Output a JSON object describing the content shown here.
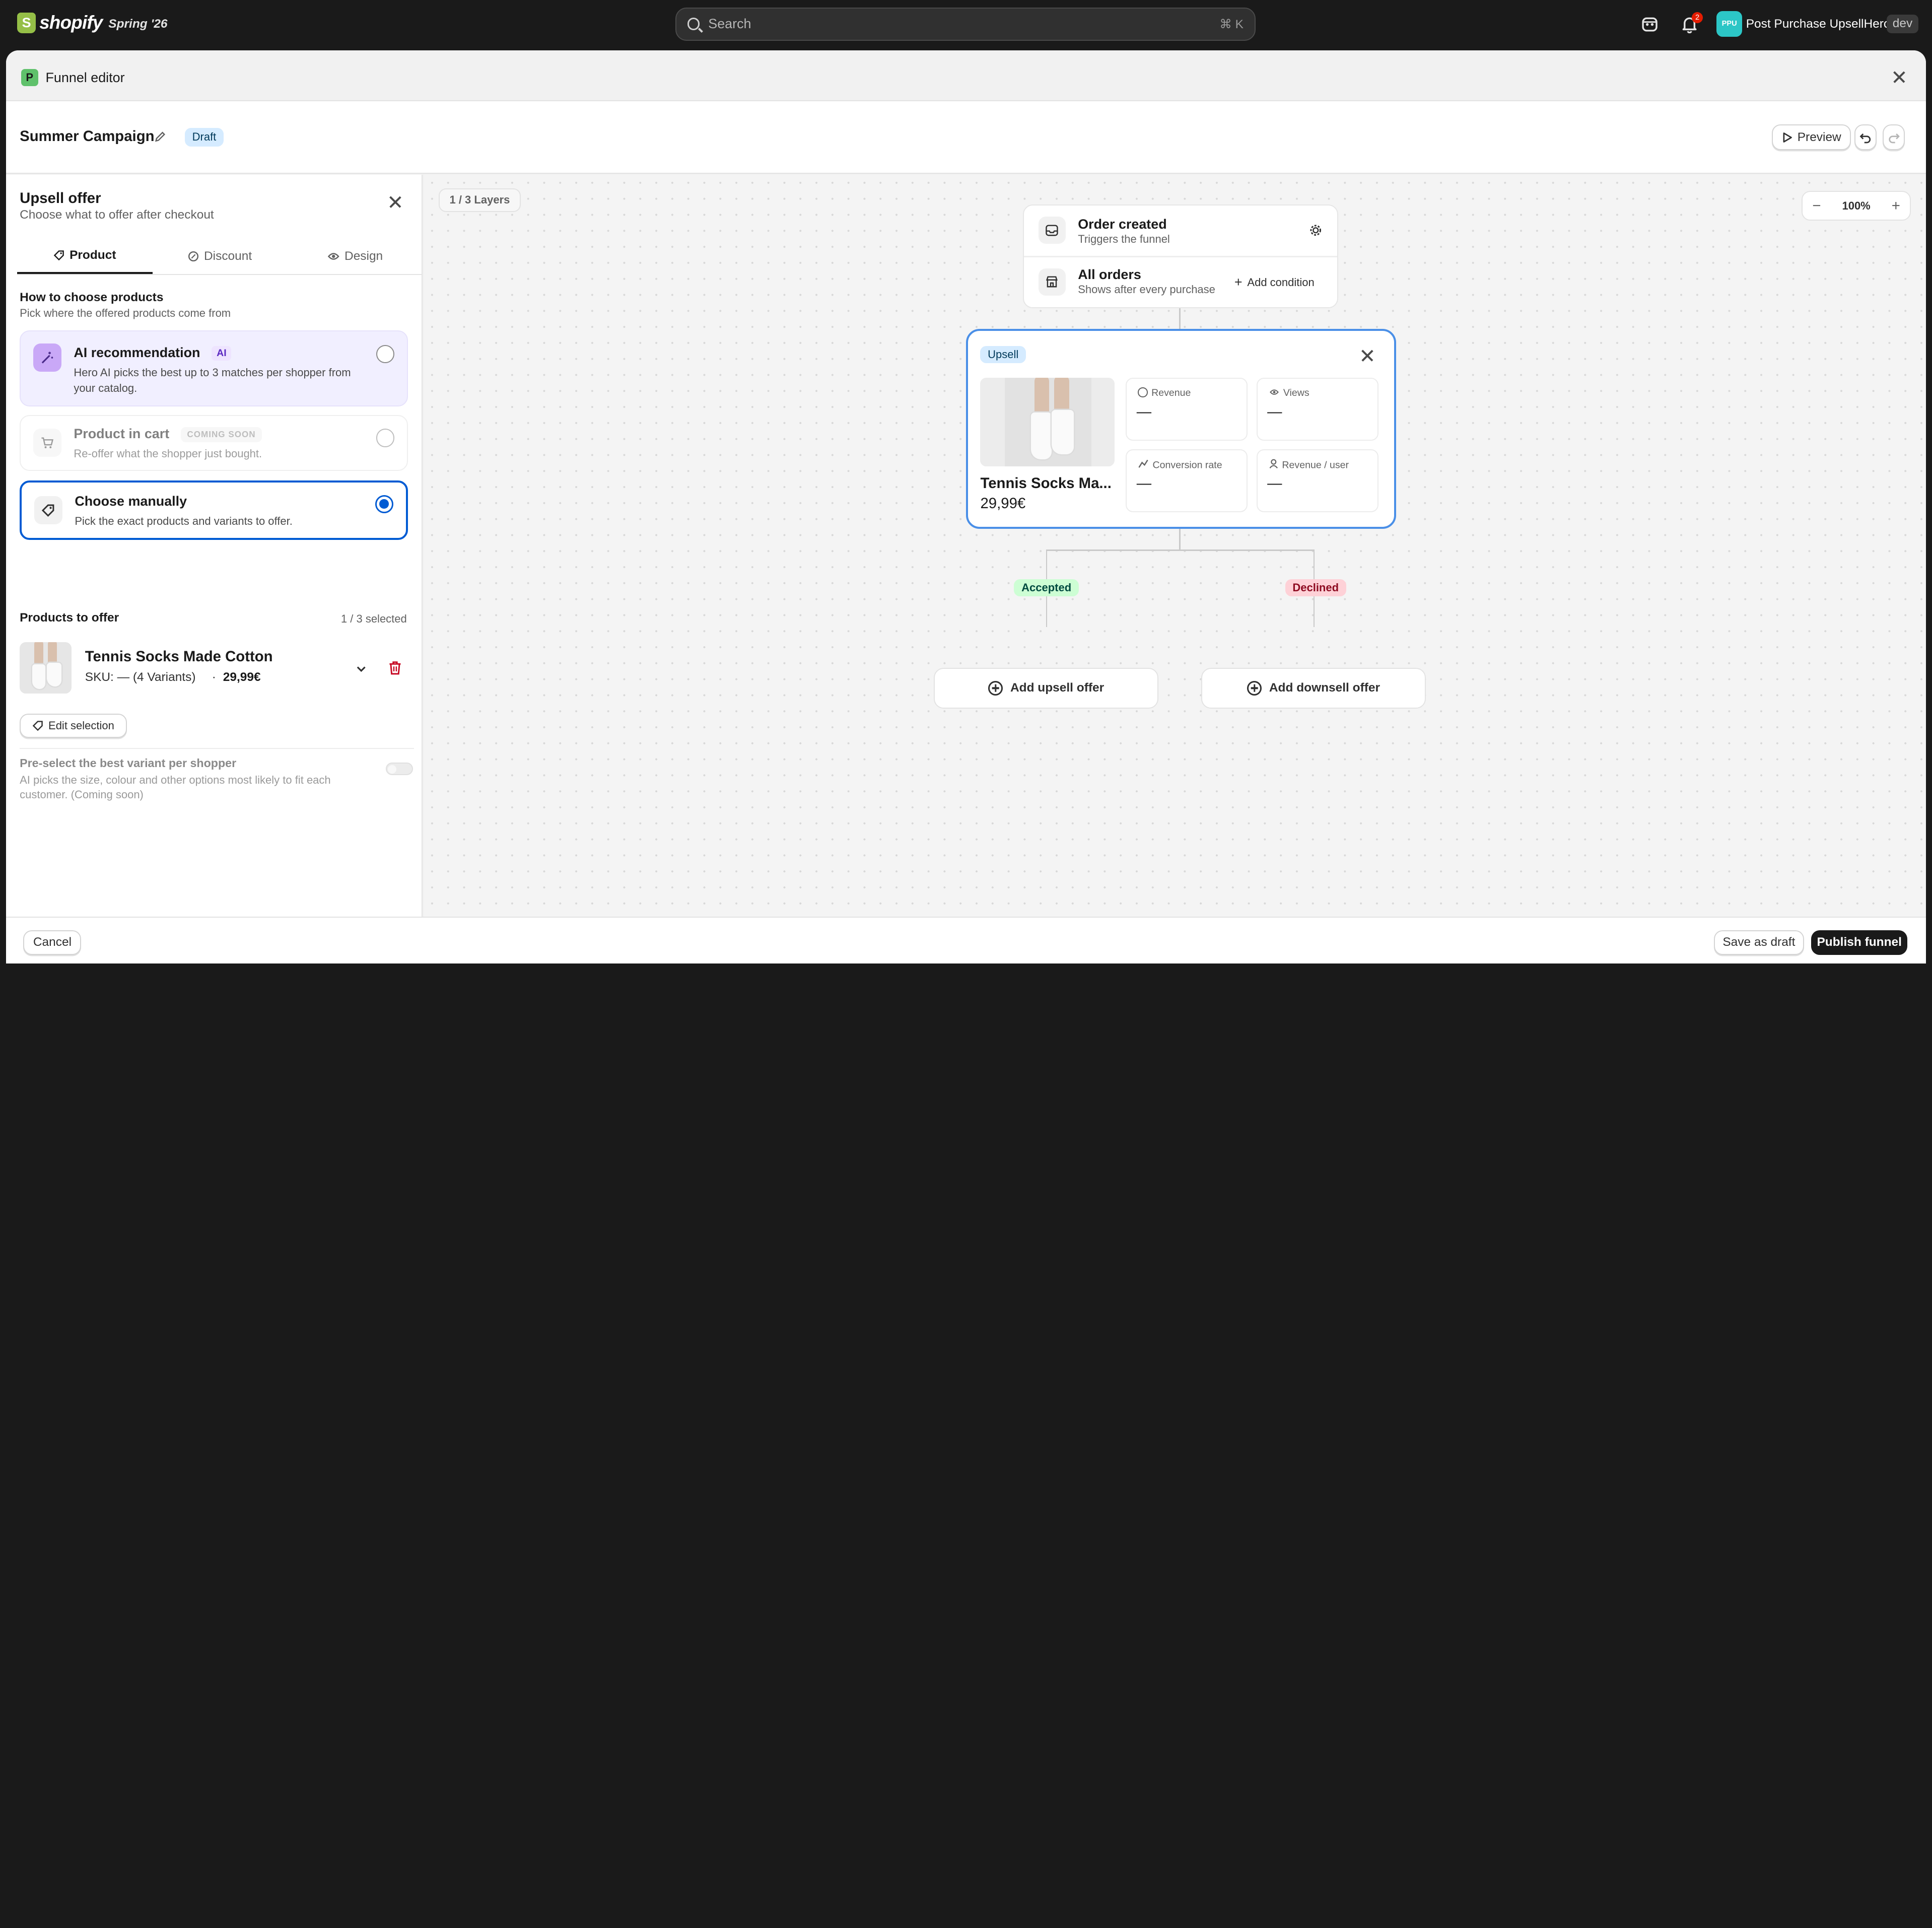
{
  "topbar": {
    "logo_text": "shopify",
    "edition": "Spring '26",
    "search_placeholder": "Search",
    "search_shortcut": "⌘ K",
    "notification_count": "2",
    "store_initials": "PPU",
    "store_name": "Post Purchase UpsellHero",
    "env_badge": "dev"
  },
  "modal": {
    "title": "Funnel editor",
    "app_icon": "P"
  },
  "editor": {
    "campaign_name": "Summer Campaign",
    "status_badge": "Draft",
    "preview_label": "Preview"
  },
  "panel": {
    "title": "Upsell offer",
    "subtitle": "Choose what to offer after checkout",
    "tabs": [
      {
        "label": "Product",
        "icon": "tag-icon",
        "active": true
      },
      {
        "label": "Discount",
        "icon": "discount-icon",
        "active": false
      },
      {
        "label": "Design",
        "icon": "eye-icon",
        "active": false
      }
    ],
    "choose_heading": "How to choose products",
    "choose_sub": "Pick where the offered products come from",
    "options": [
      {
        "title": "AI recommendation",
        "badge": "AI",
        "desc": "Hero AI picks the best up to 3 matches per shopper from your catalog.",
        "selected": false
      },
      {
        "title": "Product in cart",
        "badge": "COMING SOON",
        "desc": "Re-offer what the shopper just bought.",
        "selected": false,
        "disabled": true
      },
      {
        "title": "Choose manually",
        "badge": "",
        "desc": "Pick the exact products and variants to offer.",
        "selected": true
      }
    ],
    "products_heading": "Products to offer",
    "products_count": "1 / 3 selected",
    "product": {
      "name": "Tennis Socks Made Cotton",
      "sku": "SKU: — (4 Variants)",
      "separator": "·",
      "price": "29,99€"
    },
    "edit_selection": "Edit selection",
    "preselect_title": "Pre-select the best variant per shopper",
    "preselect_desc": "AI picks the size, colour and other options most likely to fit each customer. (Coming soon)"
  },
  "canvas": {
    "layers_label": "1 / 3 Layers",
    "zoom_level": "100%",
    "trigger": {
      "title": "Order created",
      "subtitle": "Triggers the funnel"
    },
    "condition": {
      "title": "All orders",
      "subtitle": "Shows after every purchase",
      "add_label": "Add condition"
    },
    "upsell": {
      "tag": "Upsell",
      "product_name": "Tennis Socks Ma...",
      "price": "29,99€",
      "stats": [
        {
          "label": "Revenue",
          "value": "—",
          "icon": "dollar-circle-icon"
        },
        {
          "label": "Views",
          "value": "—",
          "icon": "eye-icon"
        },
        {
          "label": "Conversion rate",
          "value": "—",
          "icon": "trend-icon"
        },
        {
          "label": "Revenue / user",
          "value": "—",
          "icon": "user-icon"
        }
      ]
    },
    "accepted_label": "Accepted",
    "declined_label": "Declined",
    "add_upsell": "Add upsell offer",
    "add_downsell": "Add downsell offer"
  },
  "footer": {
    "cancel": "Cancel",
    "save_draft": "Save as draft",
    "publish": "Publish funnel"
  },
  "colors": {
    "accent_blue": "#005bd3",
    "upsell_border": "#4a8fe7",
    "accepted_bg": "#cdfed4",
    "declined_bg": "#fed1d7",
    "ai_option_bg": "#f1efff",
    "publish_bg": "#1a1a1a"
  }
}
